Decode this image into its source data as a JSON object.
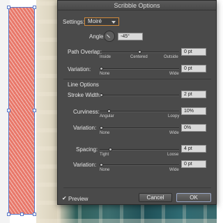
{
  "dialog": {
    "title": "Scribble Options",
    "settings_label": "Settings:",
    "settings_value": "Moiré",
    "angle_label": "Angle:",
    "angle_value": "-45°",
    "path_overlap": {
      "label": "Path Overlap:",
      "value": "0 pt",
      "min_label": "Inside",
      "mid_label": "Centered",
      "max_label": "Outside",
      "level": 0.5
    },
    "path_variation": {
      "label": "Variation:",
      "value": "0 pt",
      "min_label": "None",
      "max_label": "Wide",
      "level": 0
    },
    "line_options_heading": "Line Options",
    "stroke_width": {
      "label": "Stroke Width:",
      "value": "2 pt",
      "level": 0
    },
    "curviness": {
      "label": "Curviness:",
      "value": "10%",
      "min_label": "Angular",
      "max_label": "Loopy",
      "level": 0.1
    },
    "curviness_variation": {
      "label": "Variation:",
      "value": "0%",
      "min_label": "None",
      "max_label": "Wide",
      "level": 0
    },
    "spacing": {
      "label": "Spacing:",
      "value": "4 pt",
      "min_label": "Tight",
      "max_label": "Loose",
      "level": 0.12
    },
    "spacing_variation": {
      "label": "Variation:",
      "value": "0 pt",
      "min_label": "None",
      "max_label": "Wide",
      "level": 0
    },
    "preview_label": "Preview",
    "preview_checked": true,
    "cancel_label": "Cancel",
    "ok_label": "OK",
    "accent_color": "#d08a3c"
  }
}
